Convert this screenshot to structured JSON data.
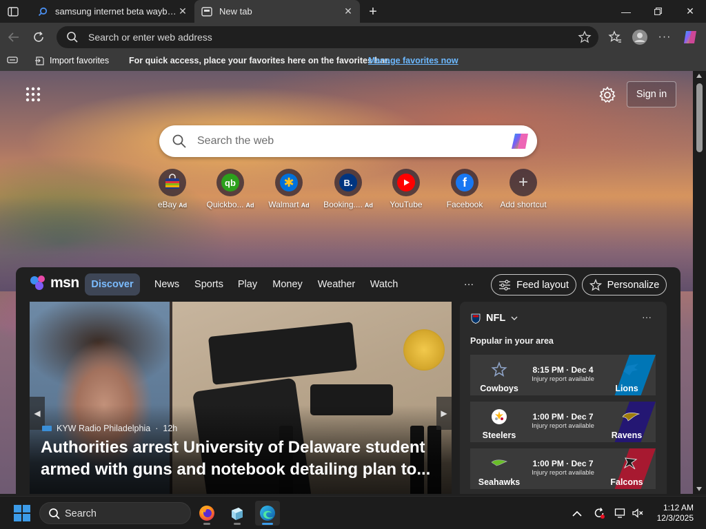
{
  "tabs": [
    {
      "title": "samsung internet beta wayback m",
      "active": false
    },
    {
      "title": "New tab",
      "active": true
    }
  ],
  "address_bar": {
    "placeholder": "Search or enter web address"
  },
  "favorites_bar": {
    "import_label": "Import favorites",
    "message": "For quick access, place your favorites here on the favorites bar.",
    "link": "Manage favorites now"
  },
  "header": {
    "sign_in_label": "Sign in"
  },
  "web_search": {
    "placeholder": "Search the web"
  },
  "shortcuts": [
    {
      "label": "eBay",
      "ad": "Ad",
      "icon": "ebay-icon",
      "color": "#1f3a8a"
    },
    {
      "label": "Quickbo...",
      "ad": "Ad",
      "icon": "quickbooks-icon",
      "color": "#2ca01c"
    },
    {
      "label": "Walmart",
      "ad": "Ad",
      "icon": "walmart-icon",
      "color": "#0071dc"
    },
    {
      "label": "Booking....",
      "ad": "Ad",
      "icon": "booking-icon",
      "color": "#003580"
    },
    {
      "label": "YouTube",
      "ad": "",
      "icon": "youtube-icon",
      "color": "#ff0000"
    },
    {
      "label": "Facebook",
      "ad": "",
      "icon": "facebook-icon",
      "color": "#1877f2"
    },
    {
      "label": "Add shortcut",
      "ad": "",
      "icon": "plus-icon",
      "color": "#5a5a5a"
    }
  ],
  "feed": {
    "brand": "msn",
    "nav": [
      "Discover",
      "News",
      "Sports",
      "Play",
      "Money",
      "Weather",
      "Watch"
    ],
    "more": "···",
    "feed_layout_label": "Feed layout",
    "personalize_label": "Personalize"
  },
  "hero": {
    "source": "KYW Radio Philadelphia",
    "age": "12h",
    "title": "Authorities arrest University of Delaware student armed with guns and notebook detailing plan to..."
  },
  "nfl": {
    "title": "NFL",
    "subtitle": "Popular in your area",
    "games": [
      {
        "home": "Cowboys",
        "away": "Lions",
        "time": "8:15 PM · Dec 4",
        "note": "Injury report available",
        "home_color": "#8ea3c7",
        "away_color": "#0076b6"
      },
      {
        "home": "Steelers",
        "away": "Ravens",
        "time": "1:00 PM · Dec 7",
        "note": "Injury report available",
        "home_color": "#ffb612",
        "away_color": "#241773"
      },
      {
        "home": "Seahawks",
        "away": "Falcons",
        "time": "1:00 PM · Dec 7",
        "note": "Injury report available",
        "home_color": "#69be28",
        "away_color": "#a71930"
      }
    ]
  },
  "taskbar": {
    "search_label": "Search",
    "time": "1:12 AM",
    "date": "12/3/2025"
  },
  "colors": {
    "accent": "#3c9be8",
    "link": "#6cb8ff",
    "nav_active": "#7bbcff"
  }
}
